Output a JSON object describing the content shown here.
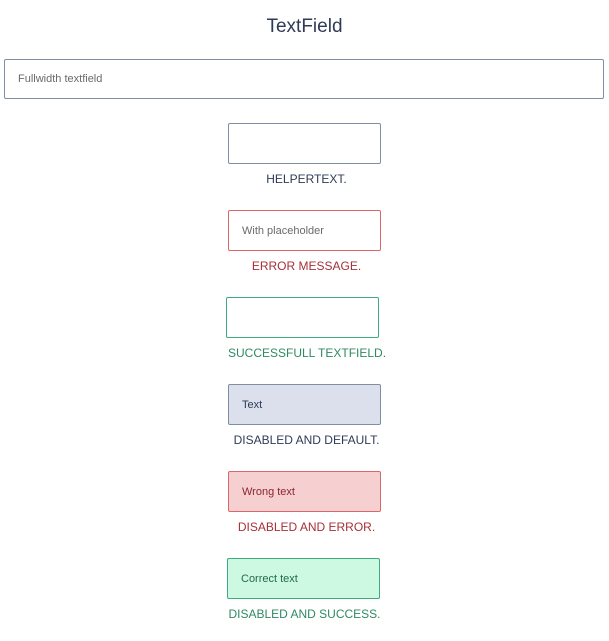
{
  "page": {
    "title": "TextField"
  },
  "fields": {
    "fullwidth": {
      "placeholder": "Fullwidth textfield",
      "value": ""
    },
    "helper": {
      "placeholder": "",
      "value": "",
      "helper_text": "HELPERTEXT."
    },
    "error": {
      "placeholder": "With placeholder",
      "value": "",
      "helper_text": "ERROR MESSAGE."
    },
    "success": {
      "placeholder": "",
      "value": "",
      "helper_text": "SUCCESSFULL TEXTFIELD."
    },
    "disabled_default": {
      "value": "Text",
      "helper_text": "DISABLED AND DEFAULT."
    },
    "disabled_error": {
      "value": "Wrong text",
      "helper_text": "DISABLED AND ERROR."
    },
    "disabled_success": {
      "value": "Correct text",
      "helper_text": "DISABLED AND SUCCESS."
    }
  },
  "colors": {
    "default_border": "#7e8fa3",
    "error": "#d9676b",
    "error_text": "#a72f38",
    "success": "#3fa97f",
    "success_text": "#2e8a63",
    "disabled_default_bg": "#dbe0ec",
    "disabled_error_bg": "#f6cfd1",
    "disabled_success_bg": "#cdf8e2"
  }
}
